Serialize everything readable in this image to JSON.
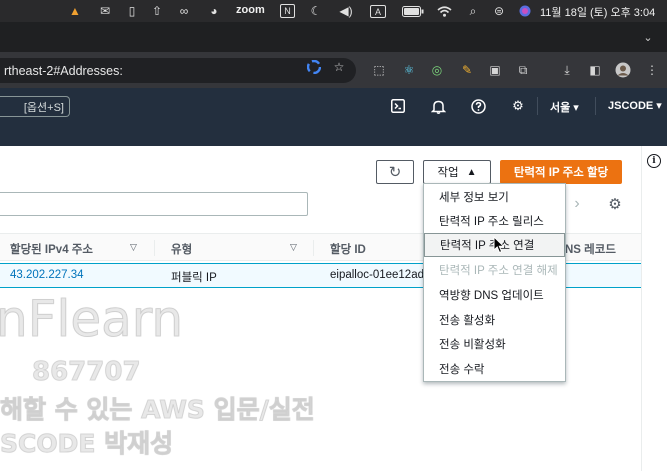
{
  "menubar": {
    "zoom_label": "zoom",
    "clock": "11월 18일 (토) 오후 3:04",
    "icons": [
      "vlc-icon",
      "mail-icon",
      "doc-icon",
      "upload-icon",
      "glasses-icon",
      "palette-icon",
      "zoom-icon",
      "notion-icon",
      "moon-icon",
      "volume-icon",
      "input-icon",
      "battery-icon",
      "wifi-icon",
      "search-icon",
      "control-center-icon",
      "siri-icon"
    ],
    "input_indicator": "A",
    "notion_letter": "N"
  },
  "browser": {
    "url": "rtheast-2#Addresses:"
  },
  "aws_nav": {
    "search_shortcut": "[옵션+S]",
    "region": "서울",
    "account": "JSCODE"
  },
  "toolbar": {
    "refresh_icon": "↻",
    "actions_label": "작업",
    "primary_label": "탄력적 IP 주소 할당"
  },
  "table": {
    "columns": [
      {
        "label": "할당된 IPv4 주소",
        "sortable": true
      },
      {
        "label": "유형",
        "sortable": true
      },
      {
        "label": "할당 ID",
        "sortable": false
      },
      {
        "label": "NS 레코드",
        "sortable": false
      }
    ],
    "rows": [
      {
        "ip": "43.202.227.34",
        "type": "퍼블릭 IP",
        "alloc_id": "eipalloc-01ee12ad"
      }
    ]
  },
  "actions_menu": {
    "items": [
      {
        "label": "세부 정보 보기",
        "disabled": false,
        "hover": false
      },
      {
        "label": "탄력적 IP 주소 릴리스",
        "disabled": false,
        "hover": false
      },
      {
        "label": "탄력적 IP 주소 연결",
        "disabled": false,
        "hover": true
      },
      {
        "label": "탄력적 IP 주소 연결 해제",
        "disabled": true,
        "hover": false
      },
      {
        "label": "역방향 DNS 업데이트",
        "disabled": false,
        "hover": false
      },
      {
        "label": "전송 활성화",
        "disabled": false,
        "hover": false
      },
      {
        "label": "전송 비활성화",
        "disabled": false,
        "hover": false
      },
      {
        "label": "전송 수락",
        "disabled": false,
        "hover": false
      }
    ]
  },
  "watermark": {
    "brand": "nFlearn",
    "id": "867707",
    "line1": "해할 수 있는 AWS 입문/실전",
    "line2": "SCODE 박재성"
  },
  "colors": {
    "accent": "#ec7211",
    "link": "#0073bb",
    "nav_bg": "#232f3e",
    "selected_row_bg": "#f1faff",
    "selected_row_border": "#00a1c9"
  }
}
